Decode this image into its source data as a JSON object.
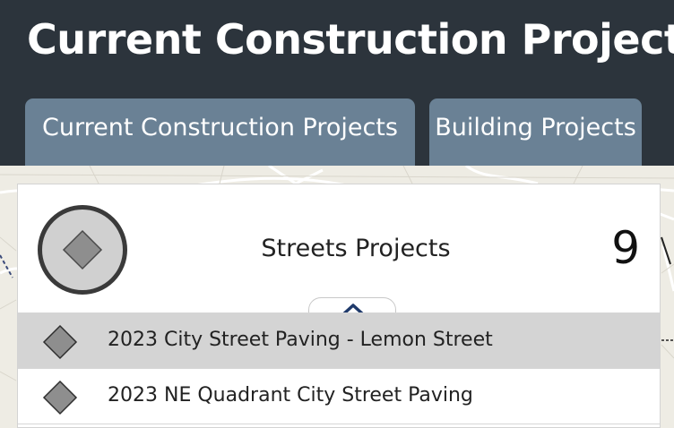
{
  "header": {
    "title": "Current Construction Projects"
  },
  "tabs": [
    {
      "label": "Current Construction Projects",
      "active": true
    },
    {
      "label": "Building Projects",
      "active": false
    }
  ],
  "group": {
    "title": "Streets Projects",
    "count": "9",
    "icon": "diamond-icon"
  },
  "items": [
    {
      "label": "2023 City Street Paving - Lemon Street",
      "selected": true,
      "icon": "diamond-icon"
    },
    {
      "label": "2023 NE Quadrant City Street Paving",
      "selected": false,
      "icon": "diamond-icon"
    }
  ],
  "colors": {
    "header_bg": "#2c343c",
    "tab_bg": "#6a8195",
    "selected_row": "#d4d4d4",
    "diamond_fill": "#8e8e8e"
  }
}
